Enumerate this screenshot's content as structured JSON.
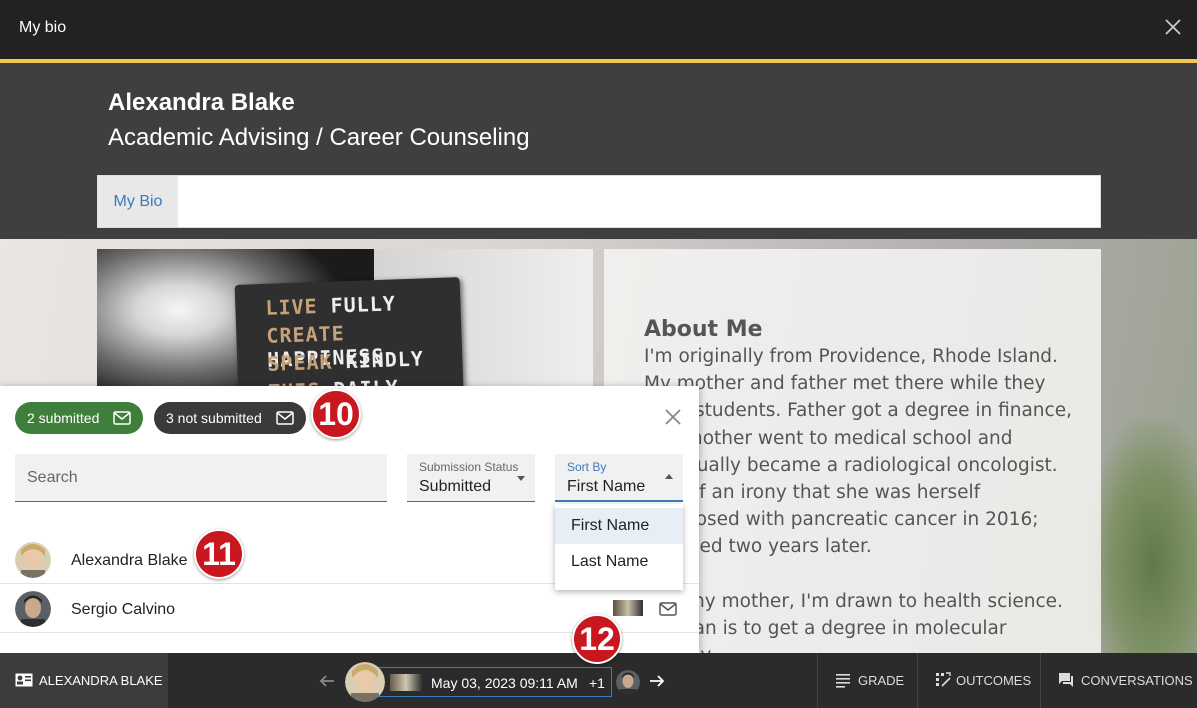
{
  "window": {
    "title": "My bio"
  },
  "profile": {
    "name": "Alexandra Blake",
    "department": "Academic Advising / Career Counseling",
    "tabs": [
      {
        "label": "My Bio"
      }
    ]
  },
  "photo": {
    "lines": [
      {
        "dim": "LIVE",
        "bright": "FULLY"
      },
      {
        "dim": "CREATE",
        "bright": "HAPPINESS"
      },
      {
        "dim": "SPEAK",
        "bright": "KINDLY"
      },
      {
        "dim": "THIS",
        "bright": "DAILY"
      }
    ]
  },
  "about": {
    "heading": "About Me",
    "paragraphs": [
      "I'm originally from Providence, Rhode Island. My mother and father met there while they were students. Father got a degree in finance, and mother went to medical school and eventually became a radiological oncologist. Sort of an irony that she was herself diagnosed with pancreatic cancer in 2016; she died two years later.",
      "Like my mother, I'm drawn to health science. My plan is to get a degree in molecular biology"
    ]
  },
  "panel": {
    "submitted_label": "2 submitted",
    "not_submitted_label": "3 not submitted",
    "search_placeholder": "Search",
    "status_filter": {
      "label": "Submission Status",
      "value": "Submitted"
    },
    "sort_by": {
      "label": "Sort By",
      "value": "First Name",
      "options": [
        "First Name",
        "Last Name"
      ]
    },
    "students": [
      {
        "name": "Alexandra Blake"
      },
      {
        "name": "Sergio Calvino"
      }
    ]
  },
  "badges": [
    "10",
    "11",
    "12"
  ],
  "bottom_bar": {
    "student_label": "ALEXANDRA BLAKE",
    "submission_time": "May 03, 2023 09:11 AM",
    "extra_count": "+1",
    "grade_label": "GRADE",
    "outcomes_label": "OUTCOMES",
    "conversations_label": "CONVERSATIONS"
  },
  "colors": {
    "accent_blue": "#3a7bbf",
    "submitted_green": "#3f7f3b",
    "badge_red": "#c8171e",
    "gold_line": "#f0c850"
  }
}
